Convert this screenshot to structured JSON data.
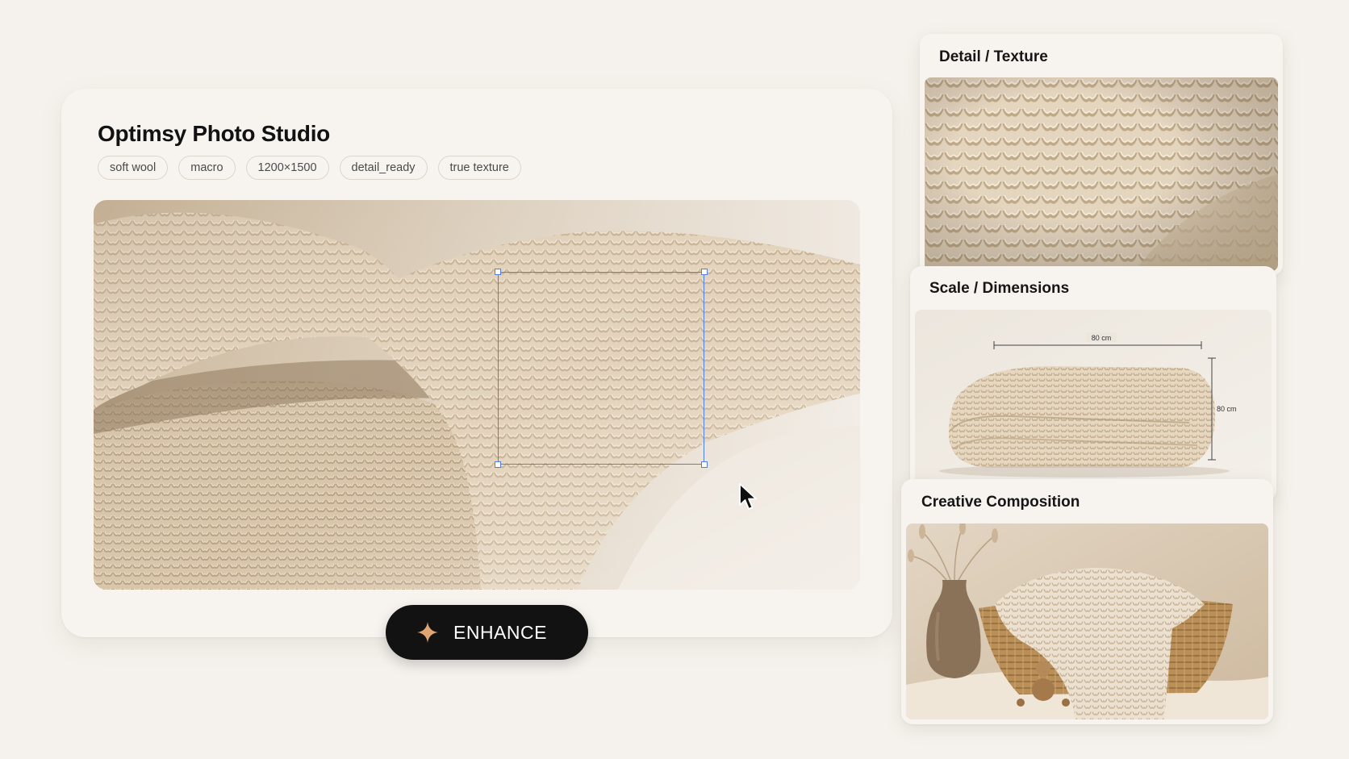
{
  "app": {
    "title": "Optimsy Photo Studio",
    "tags": [
      "soft wool",
      "macro",
      "1200×1500",
      "detail_ready",
      "true texture"
    ]
  },
  "action": {
    "enhance_label": "ENHANCE",
    "icon": "sparkle-icon"
  },
  "panels": {
    "texture": {
      "title": "Detail / Texture"
    },
    "scale": {
      "title": "Scale / Dimensions",
      "width_label": "80 cm",
      "height_label": "80 cm"
    },
    "creative": {
      "title": "Creative Composition"
    }
  },
  "colors": {
    "background": "#f5f2ed",
    "card": "#f7f4ef",
    "selection": "#4f7fe0",
    "button": "#121212",
    "sparkle": "#e0a372",
    "wool": "#e6d7c2"
  }
}
